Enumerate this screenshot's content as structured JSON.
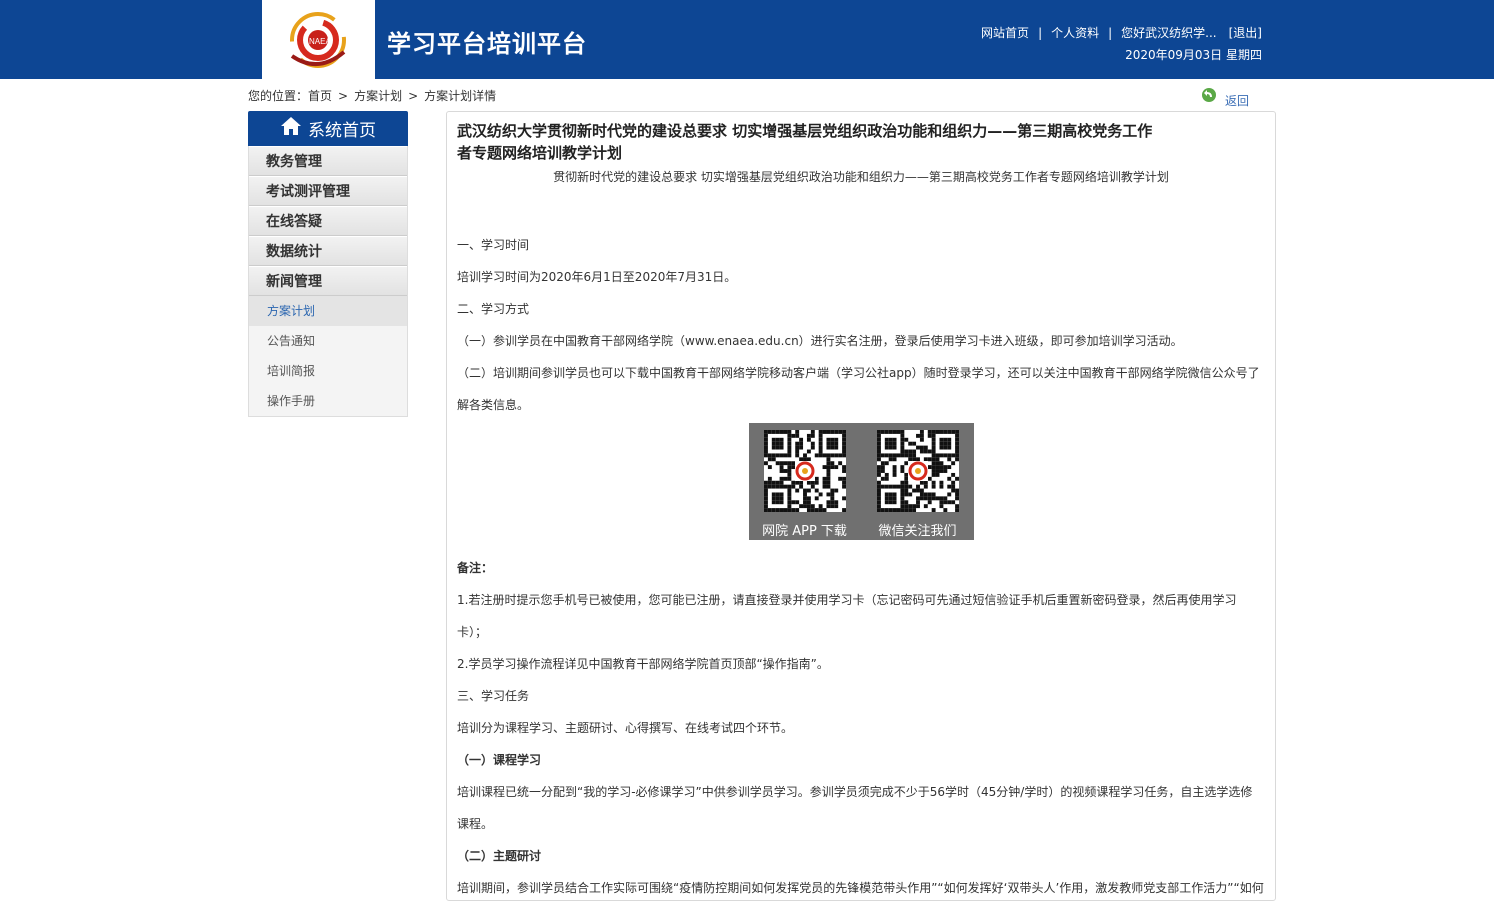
{
  "header": {
    "site_title": "学习平台培训平台",
    "links": [
      "网站首页",
      "个人资料",
      "您好武汉纺织学...",
      "[退出]"
    ],
    "date": "2020年09月03日 星期四",
    "logo_text": "NAEA"
  },
  "breadcrumb": {
    "prefix": "您的位置：",
    "items": [
      "首页",
      "方案计划",
      "方案计划详情"
    ]
  },
  "back": {
    "label": "返回"
  },
  "sidebar": {
    "home_label": "系统首页",
    "items": [
      "教务管理",
      "考试测评管理",
      "在线答疑",
      "数据统计",
      "新闻管理"
    ],
    "sub_items": [
      "方案计划",
      "公告通知",
      "培训简报",
      "操作手册"
    ],
    "active_sub": "方案计划"
  },
  "content": {
    "title": "武汉纺织大学贯彻新时代党的建设总要求 切实增强基层党组织政治功能和组织力——第三期高校党务工作者专题网络培训教学计划",
    "subtitle": "贯彻新时代党的建设总要求 切实增强基层党组织政治功能和组织力——第三期高校党务工作者专题网络培训教学计划",
    "p1": "一、学习时间",
    "p2": "培训学习时间为2020年6月1日至2020年7月31日。",
    "p3": "二、学习方式",
    "p4": "（一）参训学员在中国教育干部网络学院（www.enaea.edu.cn）进行实名注册，登录后使用学习卡进入班级，即可参加培训学习活动。",
    "p5a": "（二）培训期间参训学员也可以下载中国教育干部网络学院移动客户端（学习公社app）随时登录学习，还可以关注中国教育干部网络学院微信公众号了",
    "p5b": "解各类信息。",
    "qr_left": "网院 APP 下载",
    "qr_right": "微信关注我们",
    "note_label": "备注：",
    "note1a": "1.若注册时提示您手机号已被使用，您可能已注册，请直接登录并使用学习卡（忘记密码可先通过短信验证手机后重置新密码登录，然后再使用学习",
    "note1b": "卡）；",
    "note2": "2.学员学习操作流程详见中国教育干部网络学院首页顶部“操作指南”。",
    "p6": "三、学习任务",
    "p7": "培训分为课程学习、主题研讨、心得撰写、在线考试四个环节。",
    "p8": "（一）课程学习",
    "p9a": "培训课程已统一分配到“我的学习-必修课学习”中供参训学员学习。参训学员须完成不少于56学时（45分钟/学时）的视频课程学习任务，自主选学选修",
    "p9b": "课程。",
    "p10": "（二）主题研讨",
    "p11": "培训期间，参训学员结合工作实际可围绕“疫情防控期间如何发挥党员的先锋模范带头作用”“如何发挥好‘双带头人’作用，激发教师党支部工作活力”“如何"
  },
  "colors": {
    "brand_blue": "#0d4694",
    "link_blue": "#3a6db5"
  }
}
